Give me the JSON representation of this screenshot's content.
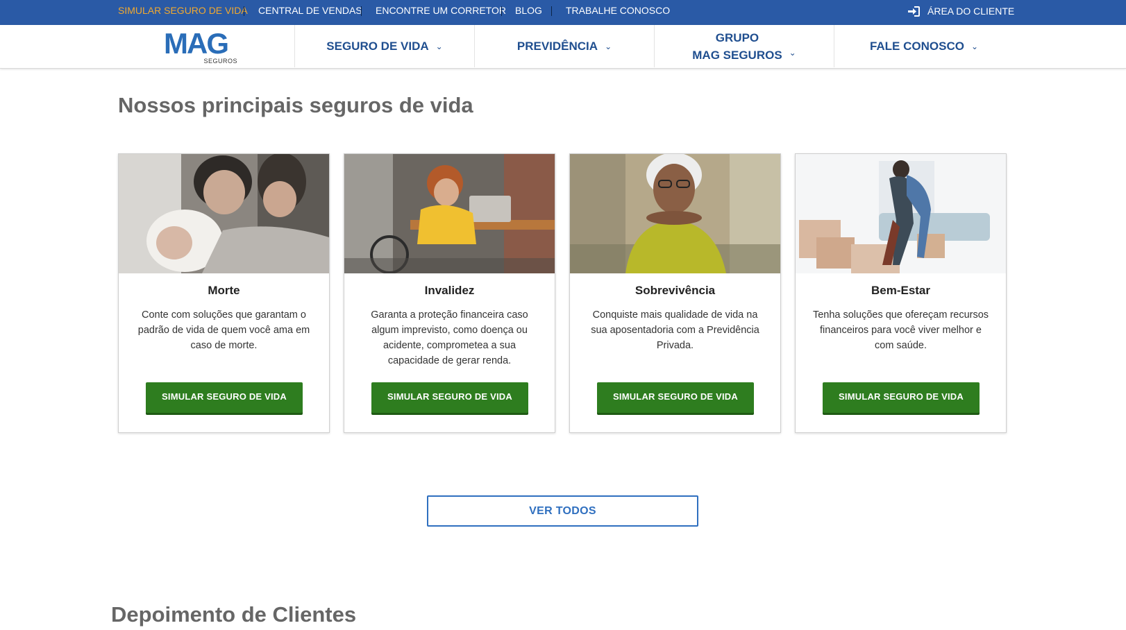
{
  "topbar": {
    "links": [
      "SIMULAR SEGURO DE VIDA",
      "CENTRAL DE VENDAS",
      "ENCONTRE UM CORRETOR",
      "BLOG",
      "TRABALHE CONOSCO"
    ],
    "client_area": "ÁREA DO CLIENTE",
    "highlight_color": "#f2a92f",
    "background_color": "#2a5aa6"
  },
  "logo": {
    "brand": "MAG",
    "sub": "SEGUROS"
  },
  "nav": {
    "items": [
      {
        "label": "SEGURO DE VIDA"
      },
      {
        "label": "PREVIDÊNCIA"
      },
      {
        "label_line1": "GRUPO",
        "label_line2": "MAG SEGUROS"
      },
      {
        "label": "FALE CONOSCO"
      }
    ]
  },
  "section": {
    "title": "Nossos principais seguros de vida"
  },
  "cards": [
    {
      "title": "Morte",
      "description": "Conte com soluções que garantam o padrão de vida de quem você ama em caso de morte.",
      "button": "SIMULAR SEGURO DE VIDA",
      "image": "family-with-newborn-photo"
    },
    {
      "title": "Invalidez",
      "description": "Garanta a proteção financeira caso algum imprevisto, como doença ou acidente, comprometea a sua capacidade de gerar renda.",
      "button": "SIMULAR SEGURO DE VIDA",
      "image": "woman-in-wheelchair-laptop-photo"
    },
    {
      "title": "Sobrevivência",
      "description": "Conquiste mais qualidade de vida na sua aposentadoria com a Previdência Privada.",
      "button": "SIMULAR SEGURO DE VIDA",
      "image": "smiling-elderly-woman-photo"
    },
    {
      "title": "Bem-Estar",
      "description": "Tenha soluções que ofereçam recursos financeiros para você viver melhor e com saúde.",
      "button": "SIMULAR SEGURO DE VIDA",
      "image": "couple-hugging-moving-boxes-photo"
    }
  ],
  "see_all": "VER TODOS",
  "section2": {
    "title": "Depoimento de Clientes"
  },
  "colors": {
    "button_green": "#2e7d1f",
    "nav_blue": "#1f4e8f",
    "link_blue": "#2f6fbf"
  }
}
